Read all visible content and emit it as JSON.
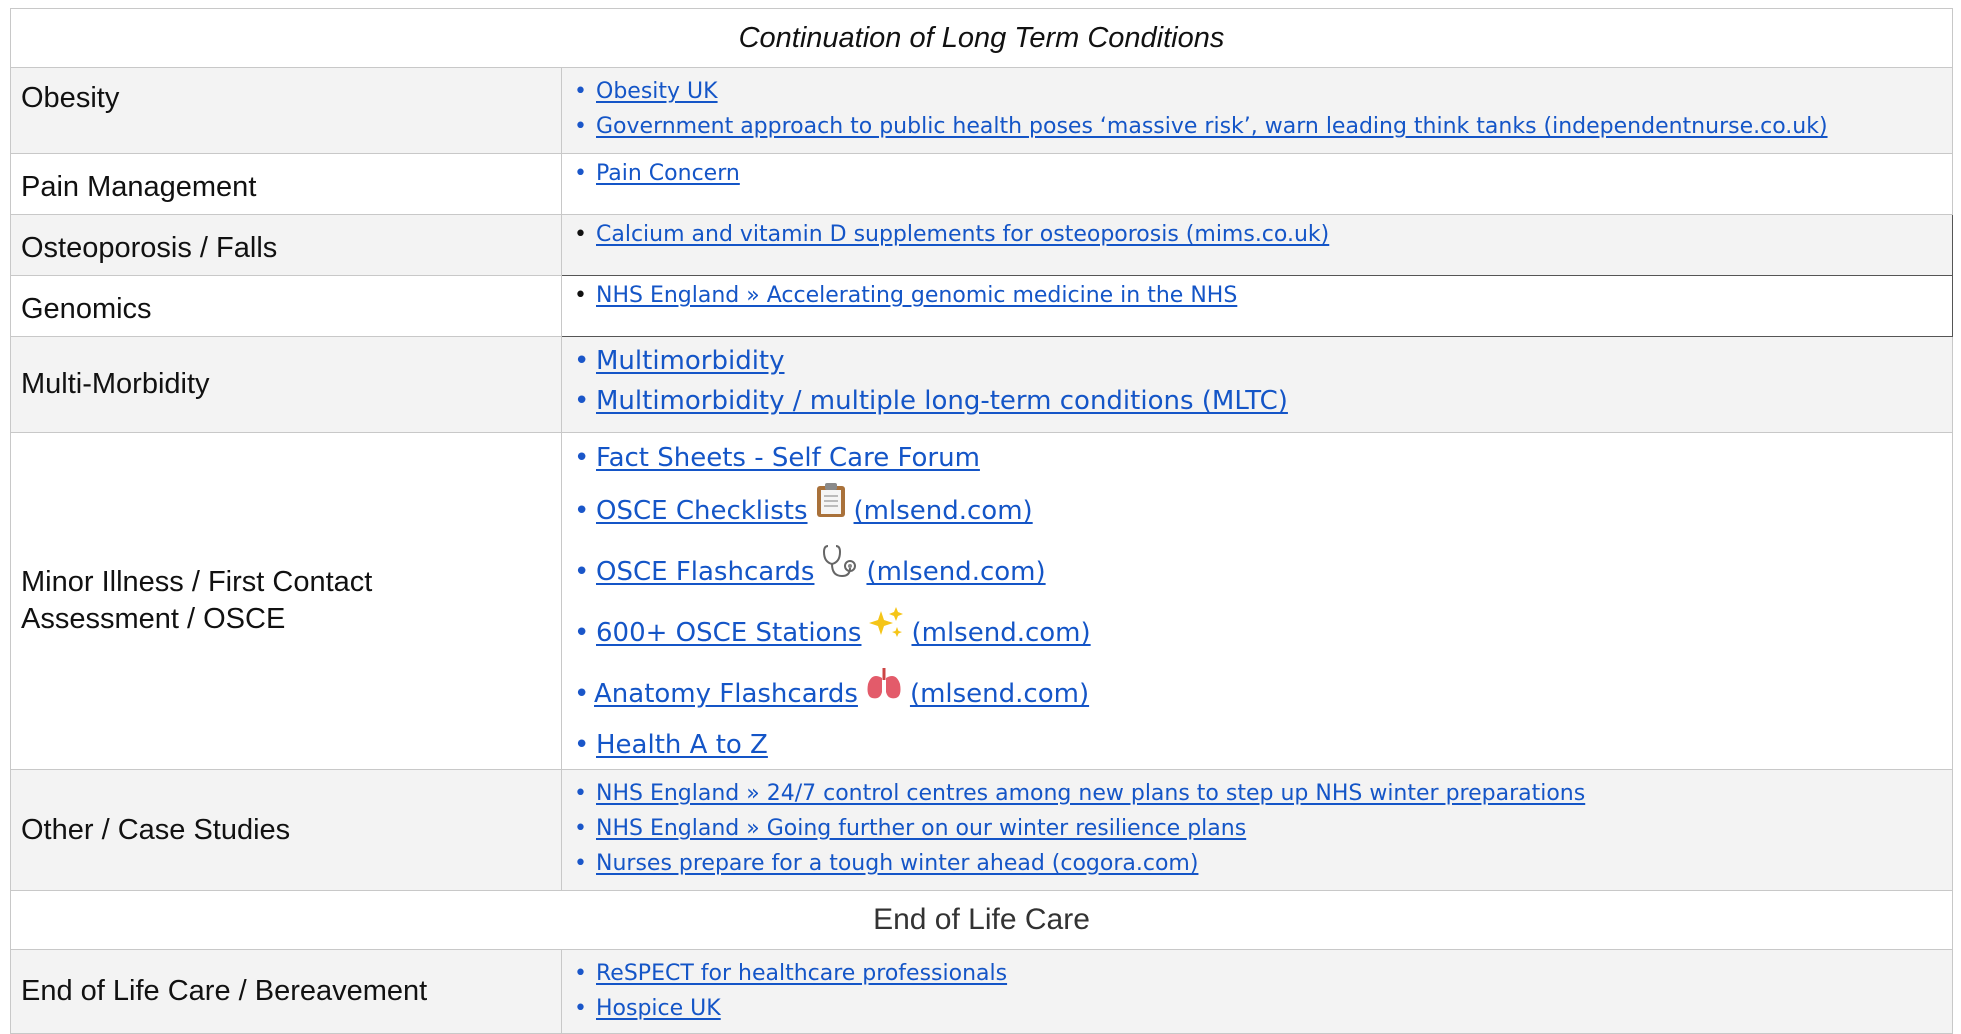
{
  "table": {
    "title": "Continuation of Long Term Conditions",
    "rows": [
      {
        "topic": "Obesity",
        "links": [
          "Obesity UK",
          "Government approach to public health poses ‘massive risk’, warn leading think tanks (independentnurse.co.uk)"
        ]
      },
      {
        "topic": "Pain Management",
        "links": [
          "Pain Concern"
        ]
      },
      {
        "topic": "Osteoporosis / Falls",
        "links": [
          "Calcium and vitamin D supplements for osteoporosis (mims.co.uk)"
        ]
      },
      {
        "topic": "Genomics",
        "links": [
          "NHS England » Accelerating genomic medicine in the NHS"
        ]
      },
      {
        "topic": "Multi-Morbidity",
        "links": [
          "Multimorbidity",
          "Multimorbidity / multiple long-term conditions (MLTC)"
        ]
      },
      {
        "topic_line1": "Minor Illness / First Contact",
        "topic_line2": "Assessment / OSCE",
        "links": [
          {
            "text": "Fact Sheets - Self Care Forum"
          },
          {
            "pre": "OSCE Checklists",
            "icon": "clipboard-icon",
            "post": "(mlsend.com)"
          },
          {
            "pre": "OSCE Flashcards",
            "icon": "stethoscope-icon",
            "post": "(mlsend.com)"
          },
          {
            "pre": "600+ OSCE Stations",
            "icon": "sparkles-icon",
            "post": "(mlsend.com)"
          },
          {
            "pre": "Anatomy Flashcards",
            "icon": "lungs-icon",
            "post": "(mlsend.com)"
          },
          {
            "text": "Health A to Z"
          }
        ]
      },
      {
        "topic": "Other / Case Studies",
        "links": [
          "NHS England » 24/7 control centres among new plans to step up NHS winter preparations",
          "NHS England » Going further on our winter resilience plans",
          "Nurses prepare for a tough winter ahead (cogora.com)"
        ]
      }
    ],
    "section2_title": "End of Life Care",
    "eol": {
      "topic": "End of Life Care / Bereavement",
      "links": [
        "ReSPECT for healthcare professionals",
        "Hospice UK"
      ]
    }
  },
  "colors": {
    "link": "#1455c7",
    "grid": "#c8c8c8",
    "row_grey": "#f3f3f3"
  }
}
